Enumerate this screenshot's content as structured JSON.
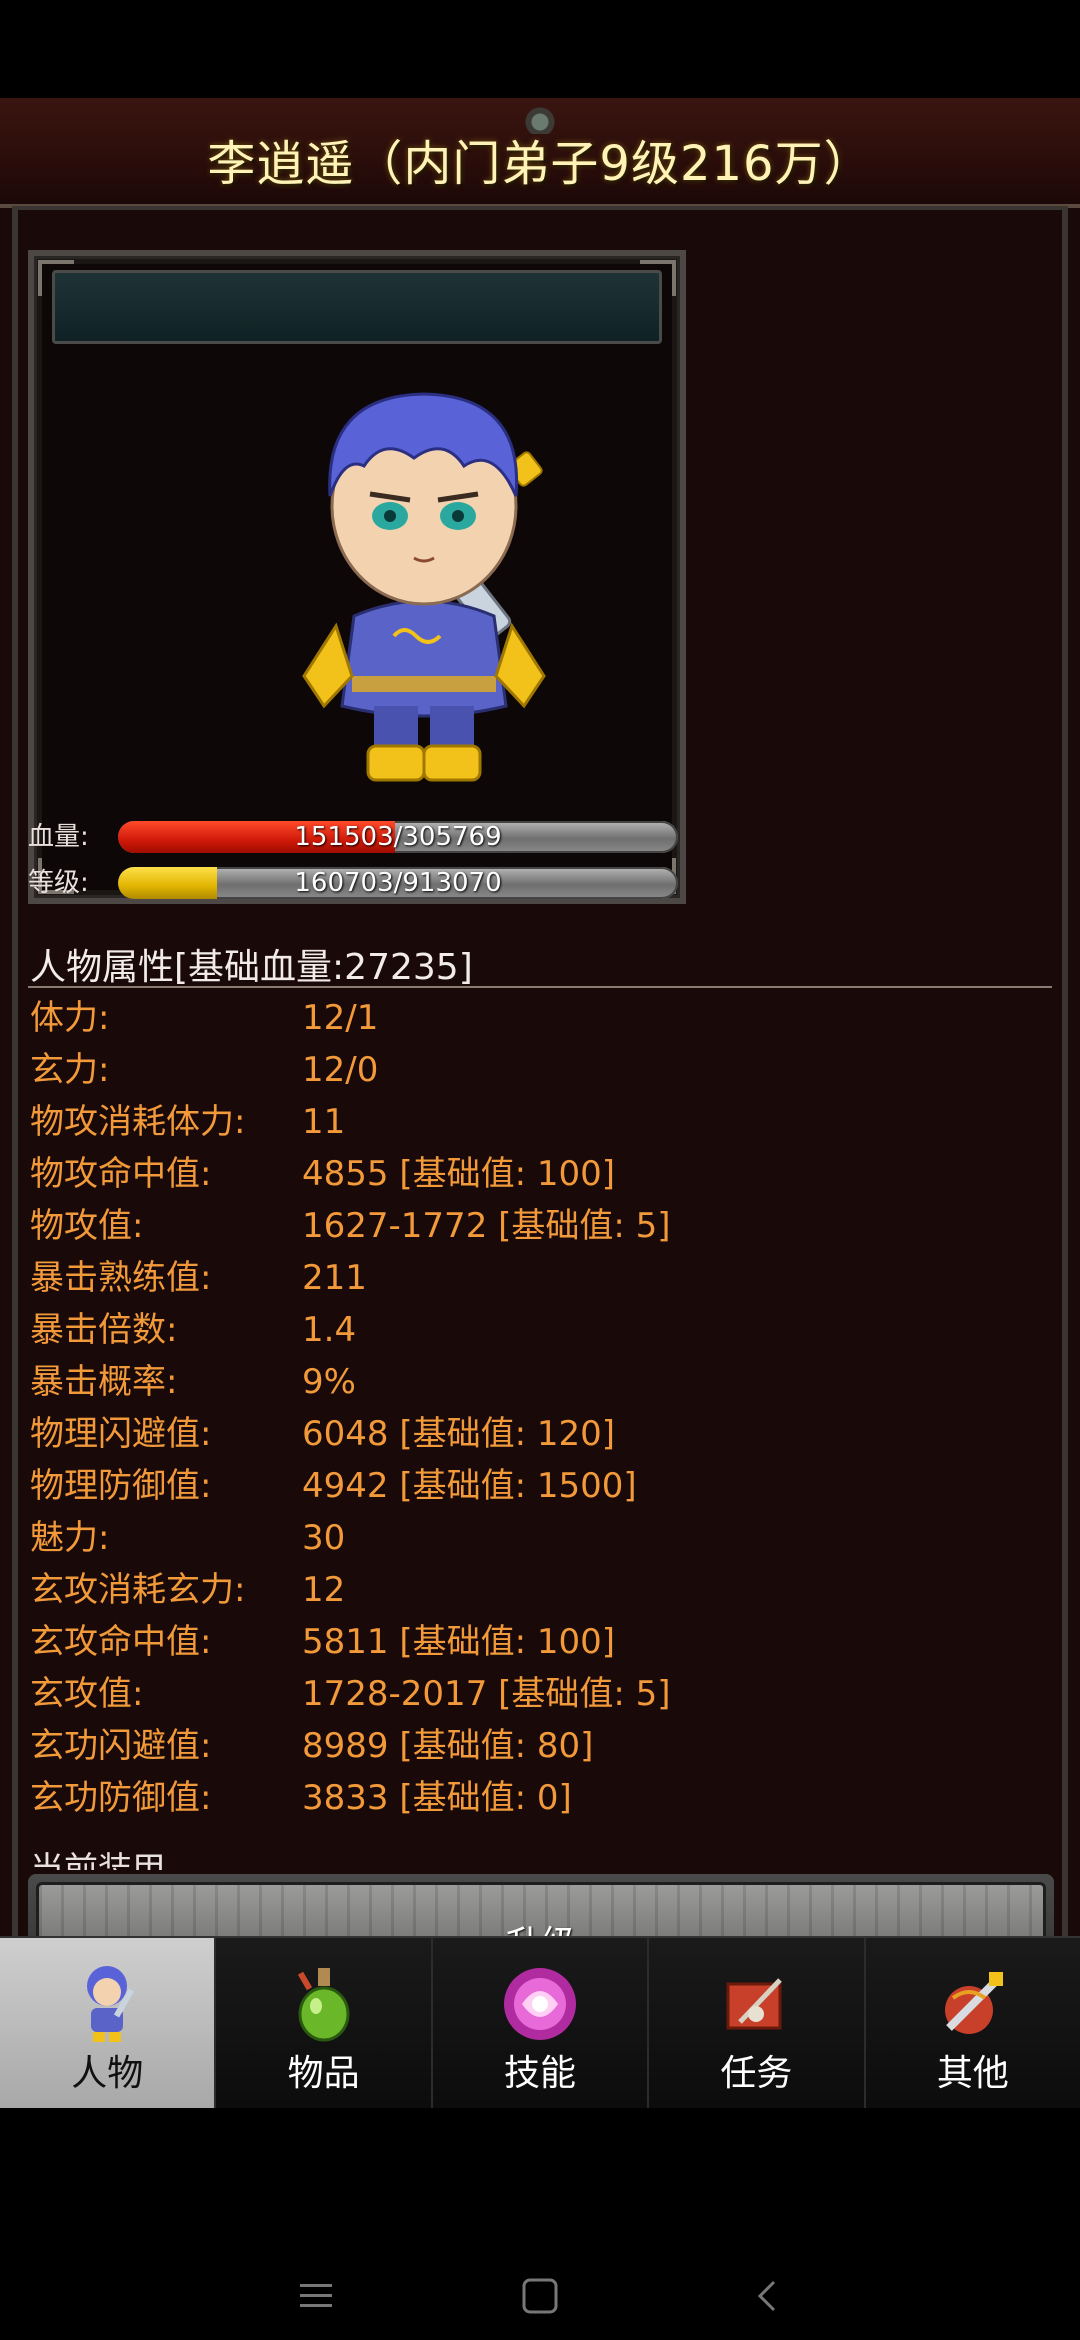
{
  "header": {
    "title": "李逍遥（内门弟子9级216万）"
  },
  "portrait": {
    "name": "character-portrait"
  },
  "bars": {
    "hp": {
      "label": "血量:",
      "text": "151503/305769",
      "fraction": 0.4955
    },
    "level": {
      "label": "等级:",
      "text": "160703/913070",
      "fraction": 0.176
    }
  },
  "attributes": {
    "title": "人物属性[基础血量:27235]",
    "rows": [
      {
        "label": "体力:",
        "value": "12/1"
      },
      {
        "label": "玄力:",
        "value": "12/0"
      },
      {
        "label": "物攻消耗体力:",
        "value": "11"
      },
      {
        "label": "物攻命中值:",
        "value": "4855 [基础值: 100]"
      },
      {
        "label": "物攻值:",
        "value": "1627-1772 [基础值: 5]"
      },
      {
        "label": "暴击熟练值:",
        "value": "211"
      },
      {
        "label": "暴击倍数:",
        "value": "1.4"
      },
      {
        "label": "暴击概率:",
        "value": "9%"
      },
      {
        "label": "物理闪避值:",
        "value": "6048 [基础值: 120]"
      },
      {
        "label": "物理防御值:",
        "value": "4942 [基础值: 1500]"
      },
      {
        "label": "魅力:",
        "value": "30"
      },
      {
        "label": "玄攻消耗玄力:",
        "value": "12"
      },
      {
        "label": "玄攻命中值:",
        "value": "5811 [基础值: 100]"
      },
      {
        "label": "玄攻值:",
        "value": "1728-2017 [基础值: 5]"
      },
      {
        "label": "玄功闪避值:",
        "value": "8989 [基础值: 80]"
      },
      {
        "label": "玄功防御值:",
        "value": "3833 [基础值: 0]"
      }
    ],
    "cut_text": "当前装甲"
  },
  "upgrade": {
    "label": "升级"
  },
  "tabs": [
    {
      "label": "人物",
      "icon": "character-icon",
      "active": true
    },
    {
      "label": "物品",
      "icon": "potion-icon",
      "active": false
    },
    {
      "label": "技能",
      "icon": "skill-orb-icon",
      "active": false
    },
    {
      "label": "任务",
      "icon": "quest-icon",
      "active": false
    },
    {
      "label": "其他",
      "icon": "other-icon",
      "active": false
    }
  ],
  "colors": {
    "attribute_text": "#f29a3a",
    "title_text": "#fff3b8",
    "hp_bar": "#d01a0a",
    "exp_bar": "#e0b400"
  }
}
